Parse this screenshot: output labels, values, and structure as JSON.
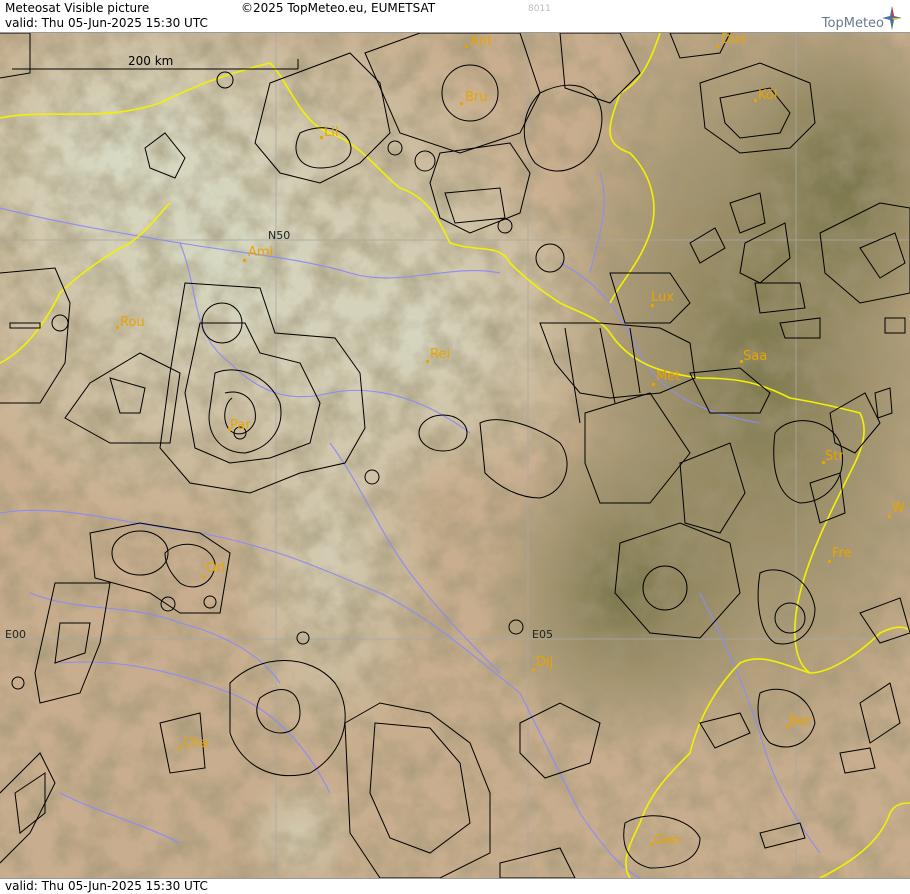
{
  "header": {
    "title": "Meteosat Visible picture",
    "valid": "valid:  Thu  05-Jun-2025  15:30 UTC",
    "copyright": "©2025 TopMeteo.eu, EUMETSAT",
    "code": "8011",
    "logo": "TopMeteo"
  },
  "footer": {
    "valid": "valid:  Thu  05-Jun-2025  15:30 UTC"
  },
  "scale": {
    "label": "200 km"
  },
  "grid_labels": {
    "n50": "N50",
    "e00": "E00",
    "e05": "E05"
  },
  "cities": {
    "ant": "Ant",
    "dus": "Düs",
    "bru": "Bru",
    "kol": "Köl",
    "lil": "Lil",
    "ami": "Ami",
    "rou": "Rou",
    "lux": "Lux",
    "rei": "Rei",
    "saa": "Saa",
    "met": "Met",
    "par": "Par",
    "str": "Str",
    "w": "W",
    "fre": "Fre",
    "orl": "Orl",
    "dij": "Dij",
    "ber": "Ber",
    "cha": "Cha",
    "gen": "Gen"
  },
  "colors": {
    "border": "#f2f200",
    "river": "#8c8cf5",
    "airspace": "#000000",
    "city": "#e8a400"
  }
}
